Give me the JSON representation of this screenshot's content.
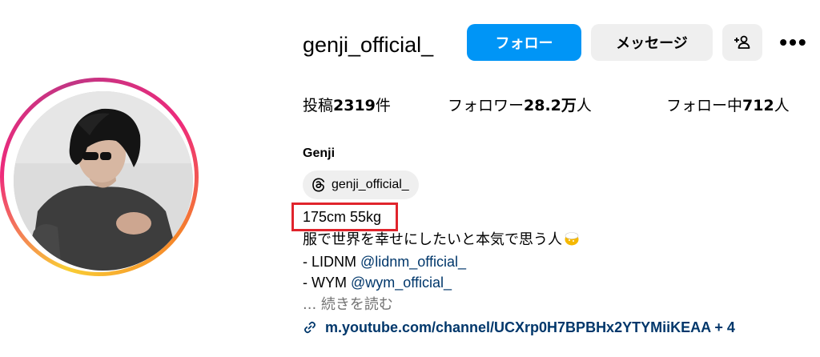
{
  "profile": {
    "username": "genji_official_",
    "display_name": "Genji",
    "avatar_icon": "profile-photo"
  },
  "actions": {
    "follow_label": "フォロー",
    "message_label": "メッセージ",
    "add_user_icon": "add-user-icon",
    "more_label": "•••"
  },
  "stats": {
    "posts_label": "投稿",
    "posts_value": "2319",
    "posts_unit": "件",
    "followers_label": "フォロワー",
    "followers_value": "28.2万",
    "followers_unit": "人",
    "following_label": "フォロー中",
    "following_value": "712",
    "following_unit": "人"
  },
  "threads": {
    "handle": "genji_official_",
    "icon": "threads-icon"
  },
  "bio": {
    "line1": "175cm 55kg",
    "line2": "服で世界を幸せにしたいと本気で思う人",
    "line3_prefix": "- LIDNM ",
    "line3_mention": "@lidnm_official_",
    "line4_prefix": "- WYM ",
    "line4_mention": "@wym_official_",
    "more": "... 続きを読む"
  },
  "link": {
    "text": "m.youtube.com/channel/UCXrp0H7BPBHx2YTYMiiKEAA + 4",
    "icon": "link-icon"
  },
  "colors": {
    "accent": "#0095f6",
    "mention": "#00376b",
    "highlight": "#e0242c",
    "button_gray": "#efefef"
  }
}
